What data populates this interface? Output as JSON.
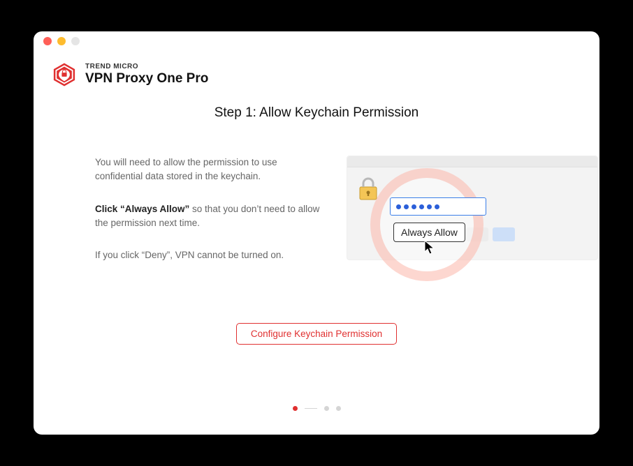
{
  "brand": {
    "company": "TREND MICRO",
    "product": "VPN Proxy One Pro"
  },
  "step": {
    "title": "Step 1: Allow Keychain Permission"
  },
  "body": {
    "intro": "You will need to allow the permission to use confidential data stored in the keychain.",
    "click_bold": "Click “Always Allow”",
    "click_rest": " so that you don’t need to allow the permission next time.",
    "deny": "If you click “Deny”, VPN cannot be turned on."
  },
  "illustration": {
    "allow_button": "Always Allow",
    "password_dots": 6
  },
  "actions": {
    "configure": "Configure Keychain Permission"
  },
  "pager": {
    "current": 1,
    "total": 3
  },
  "colors": {
    "brand_red": "#e03030",
    "accent_blue": "#3a7ee8"
  }
}
